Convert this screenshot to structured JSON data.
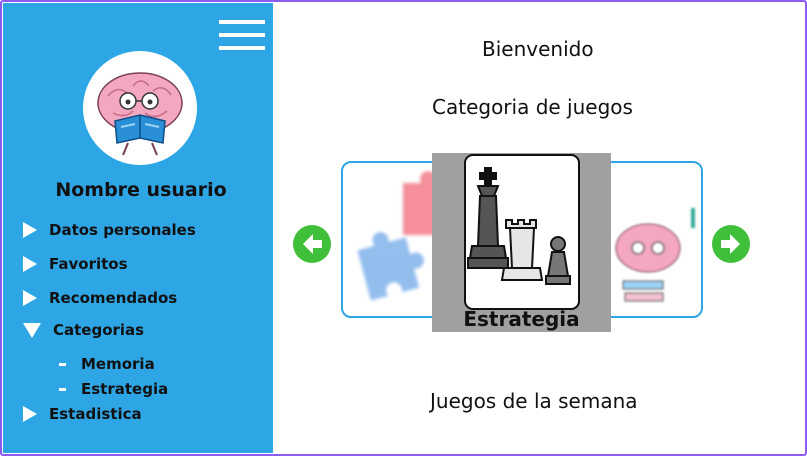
{
  "colors": {
    "sidebar": "#2ea6e6",
    "frame": "#8a5cf0",
    "arrow": "#3fbf3a",
    "focus_bg": "#a0a0a0"
  },
  "sidebar": {
    "username": "Nombre usuario",
    "items": [
      {
        "label": "Datos personales",
        "icon": "triangle-right-icon"
      },
      {
        "label": "Favoritos",
        "icon": "triangle-right-icon"
      },
      {
        "label": "Recomendados",
        "icon": "triangle-right-icon"
      },
      {
        "label": "Categorias",
        "icon": "triangle-down-icon"
      },
      {
        "label": "Estadistica",
        "icon": "triangle-right-icon"
      }
    ],
    "subitems": [
      {
        "label": "Memoria"
      },
      {
        "label": "Estrategia"
      }
    ]
  },
  "main": {
    "welcome": "Bienvenido",
    "category_title": "Categoria de juegos",
    "carousel": {
      "focused_label": "Estrategia",
      "left_icon": "puzzle-icon",
      "center_icon": "chess-icon",
      "right_icon": "brain-icon"
    },
    "weekly_title": "Juegos de la semana"
  }
}
